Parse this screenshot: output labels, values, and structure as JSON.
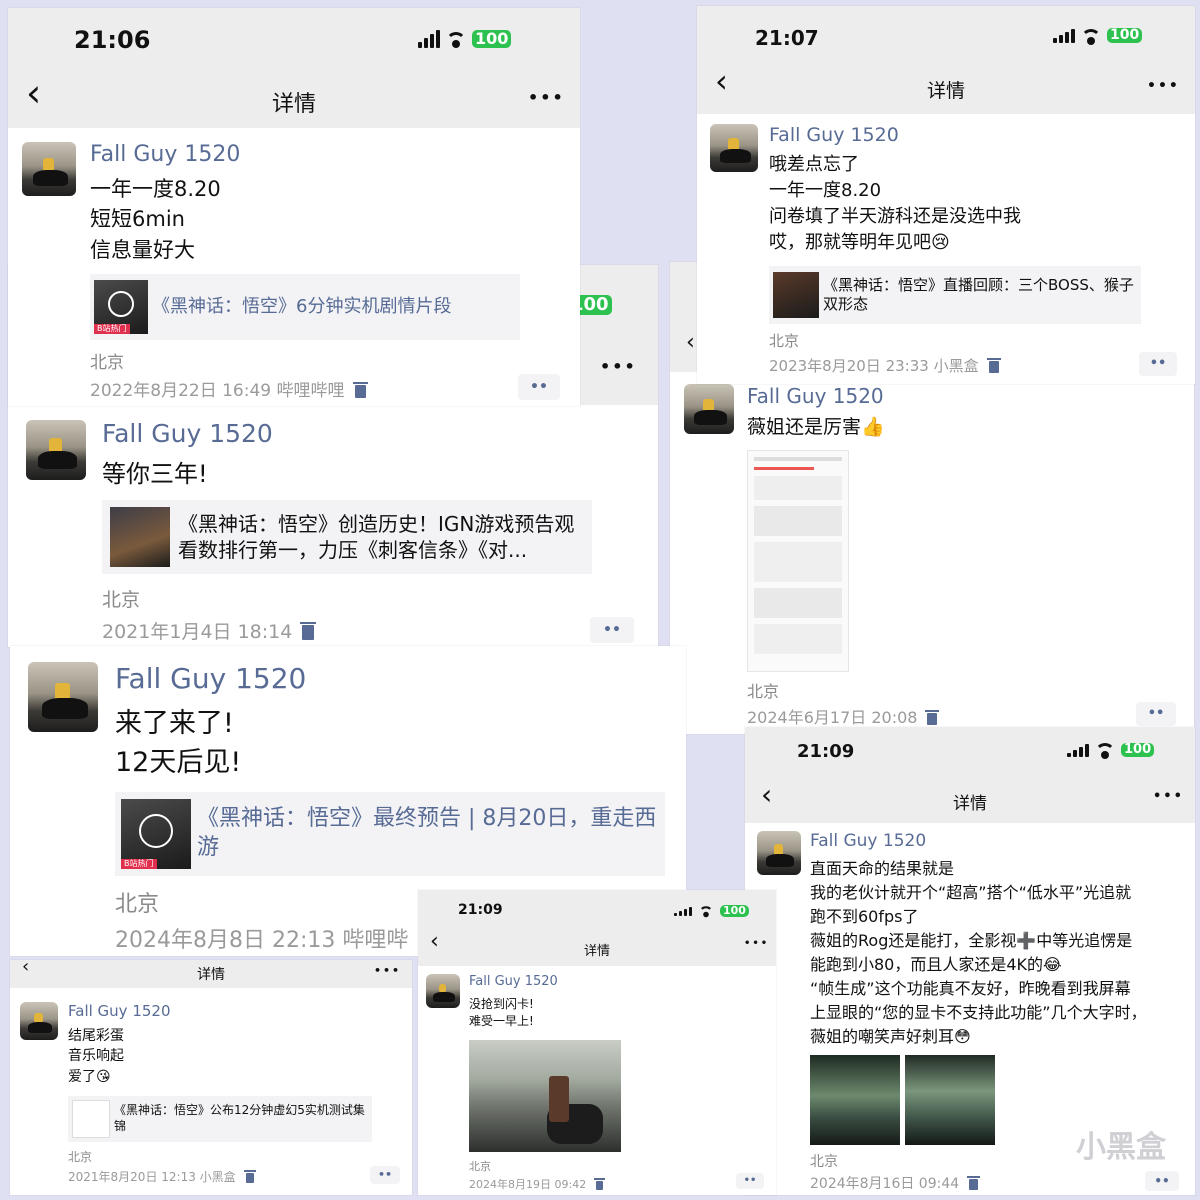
{
  "watermark": "小黑盒",
  "nav_title": "详情",
  "battery": "100",
  "more_label": "•••",
  "dots_label": "••",
  "back_label": "‹",
  "author": "Fall Guy 1520",
  "cards": {
    "c1": {
      "time": "21:06",
      "post": {
        "lines": [
          "一年一度8.20",
          "短短6min",
          "信息量好大"
        ],
        "link_tag": "B站热门",
        "link_title": "《黑神话：悟空》6分钟实机剧情片段",
        "location": "北京",
        "meta": "2022年8月22日 16:49  哔哩哔哩"
      }
    },
    "c2": {
      "post": {
        "lines": [
          "等你三年!"
        ],
        "link_title": "《黑神话：悟空》创造历史！IGN游戏预告观看数排行第一，力压《刺客信条》《对...",
        "location": "北京",
        "meta": "2021年1月4日 18:14"
      }
    },
    "c3": {
      "post": {
        "lines": [
          "来了来了!",
          "12天后见!"
        ],
        "link_tag": "B站热门",
        "link_title": "《黑神话：悟空》最终预告 | 8月20日，重走西游",
        "location": "北京",
        "meta": "2024年8月8日 22:13  哔哩哔"
      }
    },
    "c4": {
      "time": "21:07",
      "post": {
        "lines": [
          "哦差点忘了",
          "一年一度8.20",
          "问卷填了半天游科还是没选中我",
          "哎，那就等明年见吧😢"
        ],
        "link_title": "《黑神话：悟空》直播回顾：三个BOSS、猴子双形态",
        "location": "北京",
        "meta": "2023年8月20日 23:33  小黑盒"
      }
    },
    "c5": {
      "post": {
        "lines": [
          "薇姐还是厉害👍"
        ],
        "location": "北京",
        "meta": "2024年6月17日 20:08"
      }
    },
    "c6": {
      "time": "21:09",
      "post": {
        "lines": [
          "直面天命的结果就是",
          "我的老伙计就开个“超高”搭个“低水平”光追就",
          "跑不到60fps了",
          "薇姐的Rog还是能打，全影视➕中等光追愣是",
          "能跑到小80，而且人家还是4K的😂",
          "“帧生成”这个功能真不友好，昨晚看到我屏幕",
          "上显眼的“您的显卡不支持此功能”几个大字时，",
          "薇姐的嘲笑声好刺耳😳"
        ],
        "location": "北京",
        "meta": "2024年8月16日 09:44"
      }
    },
    "c7": {
      "post": {
        "lines": [
          "结尾彩蛋",
          "音乐响起",
          "爱了😘"
        ],
        "link_title": "《黑神话：悟空》公布12分钟虚幻5实机测试集锦",
        "location": "北京",
        "meta": "2021年8月20日 12:13  小黑盒"
      }
    },
    "c8": {
      "time": "21:09",
      "post": {
        "lines": [
          "没抢到闪卡!",
          "难受一早上!"
        ],
        "location": "北京",
        "meta": "2024年8月19日 09:42"
      }
    }
  }
}
